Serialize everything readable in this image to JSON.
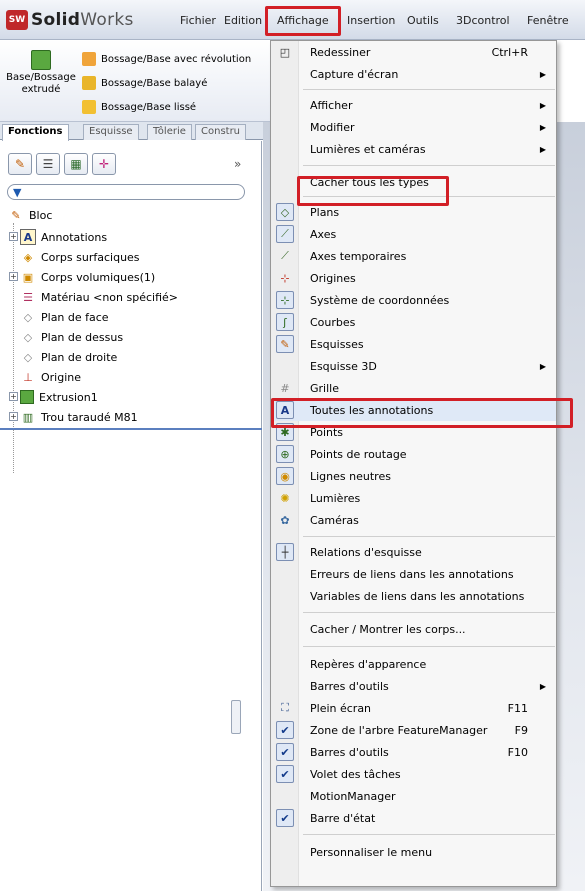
{
  "app": {
    "logo_badge": "SW",
    "logo_text_bold": "Solid",
    "logo_text_light": "Works"
  },
  "menubar": [
    "Fichier",
    "Edition",
    "Affichage",
    "Insertion",
    "Outils",
    "3Dcontrol",
    "Fenêtre"
  ],
  "toolbar": {
    "big_button": "Base/Bossage extrudé",
    "items": [
      "Bossage/Base avec révolution",
      "Bossage/Base balayé",
      "Bossage/Base lissé"
    ]
  },
  "tabs": [
    "Fonctions",
    "Esquisse",
    "Tôlerie",
    "Constru"
  ],
  "feature_tree": {
    "more": "»",
    "items": [
      "Bloc",
      "Annotations",
      "Corps surfaciques",
      "Corps volumiques(1)",
      "Matériau <non spécifié>",
      "Plan de face",
      "Plan de dessus",
      "Plan de droite",
      "Origine",
      "Extrusion1",
      "Trou taraudé M81"
    ]
  },
  "dropdown": {
    "items": [
      {
        "label": "Redessiner",
        "shortcut": "Ctrl+R"
      },
      {
        "label": "Capture d'écran"
      },
      {
        "label": "Afficher"
      },
      {
        "label": "Modifier"
      },
      {
        "label": "Lumières et caméras"
      },
      {
        "label": "Cacher tous les types"
      },
      {
        "label": "Plans"
      },
      {
        "label": "Axes"
      },
      {
        "label": "Axes temporaires"
      },
      {
        "label": "Origines"
      },
      {
        "label": "Système de coordonnées"
      },
      {
        "label": "Courbes"
      },
      {
        "label": "Esquisses"
      },
      {
        "label": "Esquisse 3D"
      },
      {
        "label": "Grille"
      },
      {
        "label": "Toutes les annotations"
      },
      {
        "label": "Points"
      },
      {
        "label": "Points de routage"
      },
      {
        "label": "Lignes neutres"
      },
      {
        "label": "Lumières"
      },
      {
        "label": "Caméras"
      },
      {
        "label": "Relations d'esquisse"
      },
      {
        "label": "Erreurs de liens dans les annotations"
      },
      {
        "label": "Variables de liens dans les annotations"
      },
      {
        "label": "Cacher / Montrer les corps..."
      },
      {
        "label": "Repères d'apparence"
      },
      {
        "label": "Barres d'outils"
      },
      {
        "label": "Plein écran",
        "shortcut": "F11"
      },
      {
        "label": "Zone de l'arbre FeatureManager",
        "shortcut": "F9"
      },
      {
        "label": "Barres d'outils",
        "shortcut": "F10"
      },
      {
        "label": "Volet des tâches"
      },
      {
        "label": "MotionManager"
      },
      {
        "label": "Barre d'état"
      },
      {
        "label": "Personnaliser le menu"
      }
    ]
  },
  "colors": {
    "highlight_box": "#d21f26",
    "menu_bg": "#f7f7f7",
    "accent": "#5b7fbf"
  }
}
